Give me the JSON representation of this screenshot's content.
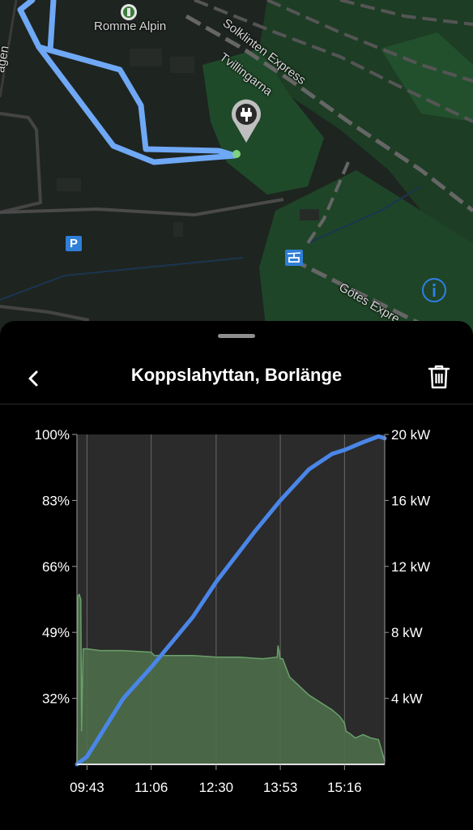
{
  "map": {
    "labels": {
      "romme_alpin": "Romme Alpin",
      "solklinten": "Solklinten Express",
      "tvillingarna": "Tvillingarna",
      "gotes": "Götes Expre",
      "road_edge": "ägen"
    },
    "parking_symbol": "P",
    "colors": {
      "background": "#1f2420",
      "forest": "#1f4a2a",
      "route": "#6fa8f5",
      "road": "#4a4a4a"
    },
    "icons": [
      "charger-pin-icon",
      "ski-lift-icon",
      "parking-icon",
      "info-icon",
      "restaurant-icon"
    ]
  },
  "sheet": {
    "title": "Koppslahyttan, Borlänge",
    "back_icon": "chevron-left-icon",
    "delete_icon": "trash-icon"
  },
  "chart_data": {
    "type": "line",
    "x_ticks": [
      "09:43",
      "11:06",
      "12:30",
      "13:53",
      "15:16"
    ],
    "xlim": [
      "09:30",
      "16:08"
    ],
    "left_axis": {
      "ticks": [
        "100%",
        "83%",
        "66%",
        "49%",
        "32%"
      ],
      "ylim": [
        15,
        100
      ]
    },
    "right_axis": {
      "ticks": [
        "20 kW",
        "16 kW",
        "12 kW",
        "8 kW",
        "4 kW"
      ],
      "ylim": [
        0,
        20
      ]
    },
    "grid": true,
    "series": [
      {
        "kind": "line",
        "axis": "left",
        "unit": "%",
        "color": "#4a86e8",
        "x": [
          "09:30",
          "09:43",
          "10:30",
          "11:06",
          "12:00",
          "12:30",
          "13:20",
          "13:53",
          "14:30",
          "15:00",
          "15:16",
          "15:40",
          "16:00",
          "16:08"
        ],
        "values": [
          15,
          17,
          32,
          40,
          53,
          62,
          75,
          83,
          91,
          95,
          96,
          98,
          99.5,
          99
        ]
      },
      {
        "kind": "area",
        "axis": "right",
        "unit": "kW",
        "color": "#6aa06a",
        "x": [
          "09:30",
          "09:31",
          "09:33",
          "09:35",
          "09:36",
          "09:38",
          "09:43",
          "10:00",
          "10:30",
          "11:06",
          "11:10",
          "12:00",
          "12:30",
          "13:00",
          "13:30",
          "13:49",
          "13:50",
          "13:53",
          "13:56",
          "14:05",
          "14:30",
          "15:00",
          "15:10",
          "15:16",
          "15:18",
          "15:22",
          "15:30",
          "15:40",
          "15:50",
          "16:00",
          "16:08"
        ],
        "values": [
          0,
          10.2,
          10.3,
          10,
          2,
          7,
          7,
          6.9,
          6.9,
          6.8,
          6.6,
          6.6,
          6.5,
          6.5,
          6.4,
          6.5,
          7.2,
          6.4,
          6.4,
          5.3,
          4.2,
          3.3,
          2.9,
          2.5,
          2.0,
          1.9,
          1.6,
          1.8,
          1.6,
          1.5,
          0.2
        ]
      }
    ]
  }
}
